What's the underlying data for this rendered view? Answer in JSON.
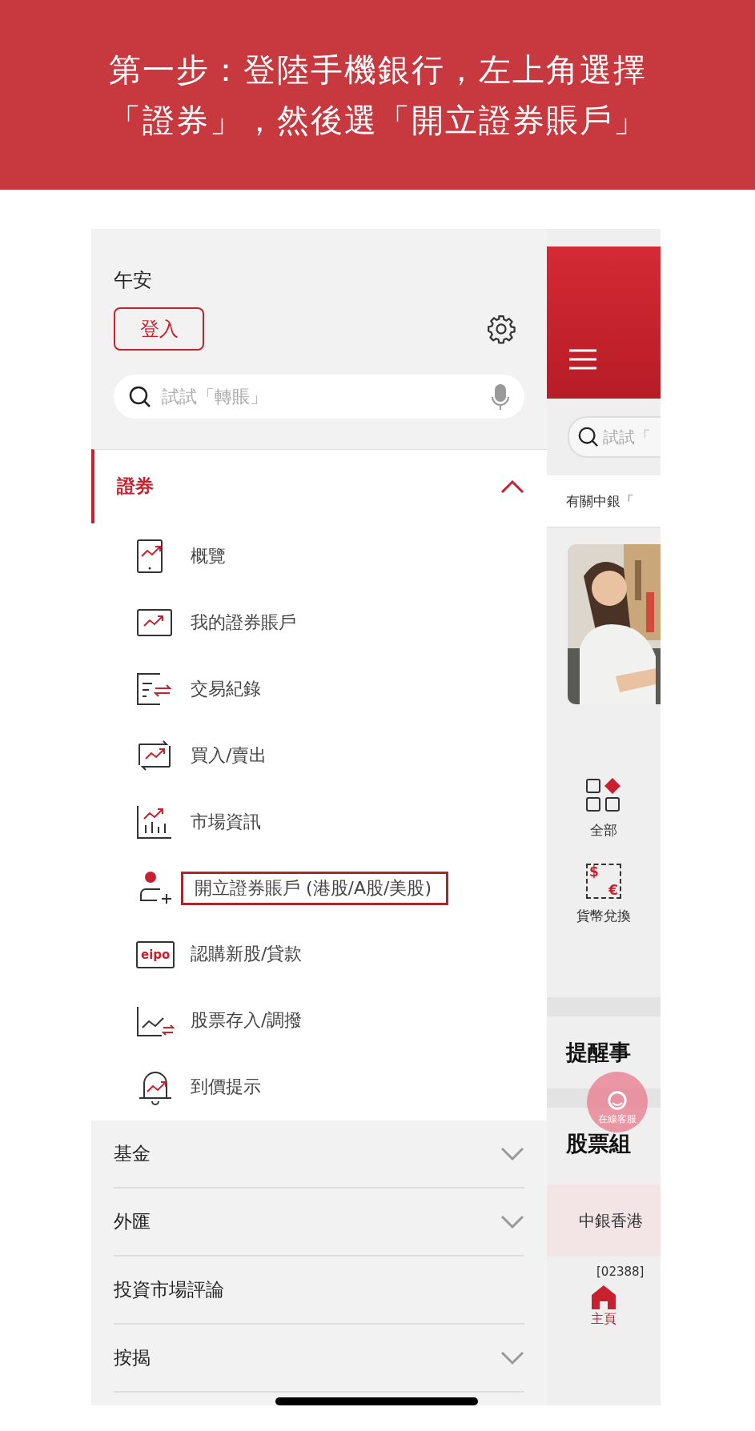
{
  "banner": {
    "lines": [
      "第一步：登陸手機銀行，左上角選擇",
      "「證券」，然後選「開立證券賬戶」"
    ]
  },
  "drawer": {
    "greeting": "午安",
    "login_button": "登入",
    "search": {
      "placeholder": "試試「轉賬」"
    },
    "sections": [
      {
        "label": "證券",
        "kind": "group",
        "selected": true,
        "expanded": true,
        "children": [
          {
            "label": "概覽",
            "highlighted": false
          },
          {
            "label": "我的證券賬戶",
            "highlighted": false
          },
          {
            "label": "交易紀錄",
            "highlighted": false
          },
          {
            "label": "買入/賣出",
            "highlighted": false
          },
          {
            "label": "市場資訊",
            "highlighted": false
          },
          {
            "label": "開立證券賬戶 (港股/A股/美股)",
            "highlighted": true
          },
          {
            "label": "認購新股/貸款",
            "highlighted": false,
            "icon_text": "eipo"
          },
          {
            "label": "股票存入/調撥",
            "highlighted": false
          },
          {
            "label": "到價提示",
            "highlighted": false
          }
        ]
      },
      {
        "label": "基金",
        "kind": "group",
        "selected": false,
        "expanded": false
      },
      {
        "label": "外匯",
        "kind": "group",
        "selected": false,
        "expanded": false
      },
      {
        "label": "投資市場評論",
        "kind": "link",
        "selected": false
      },
      {
        "label": "按揭",
        "kind": "group",
        "selected": false,
        "expanded": false
      }
    ]
  },
  "main": {
    "search": {
      "placeholder": "試試「"
    },
    "notice": "有關中銀「",
    "shortcuts": [
      {
        "label": "全部"
      },
      {
        "label": "貨幣兌換",
        "symbols": [
          "$",
          "€"
        ]
      }
    ],
    "headings": [
      "提醒事",
      "股票組"
    ],
    "chat_button": "在線客服",
    "stock_card": {
      "name": "中銀香港",
      "code": "[02388]"
    },
    "nav": [
      {
        "label": "主頁",
        "selected": true
      }
    ]
  }
}
